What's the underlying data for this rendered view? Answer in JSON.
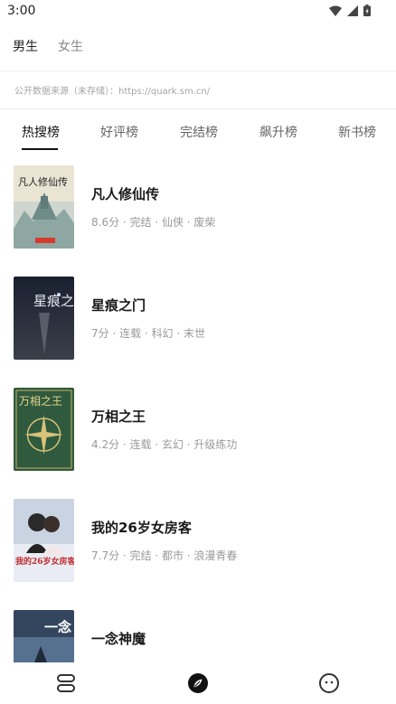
{
  "status": {
    "time": "3:00"
  },
  "gender_tabs": [
    {
      "label": "男生",
      "active": true
    },
    {
      "label": "女生",
      "active": false
    }
  ],
  "source_note": "公开数据来源（未存储）：https://quark.sm.cn/",
  "rank_tabs": [
    {
      "label": "热搜榜",
      "active": true
    },
    {
      "label": "好评榜",
      "active": false
    },
    {
      "label": "完结榜",
      "active": false
    },
    {
      "label": "飙升榜",
      "active": false
    },
    {
      "label": "新书榜",
      "active": false
    }
  ],
  "books": [
    {
      "title": "凡人修仙传",
      "meta": "8.6分 · 完结 · 仙侠 · 废柴",
      "cover_text": "凡人修仙传"
    },
    {
      "title": "星痕之门",
      "meta": "7分 · 连载 · 科幻 · 末世",
      "cover_text": "星痕之门"
    },
    {
      "title": "万相之王",
      "meta": "4.2分 · 连载 · 玄幻 · 升级练功",
      "cover_text": "万相之王"
    },
    {
      "title": "我的26岁女房客",
      "meta": "7.7分 · 完结 · 都市 · 浪漫青春",
      "cover_text": "我的26岁女房客"
    },
    {
      "title": "一念神魔",
      "meta": "",
      "cover_text": "一念"
    }
  ],
  "nav": [
    {
      "icon": "bookshelf-icon"
    },
    {
      "icon": "compass-icon"
    },
    {
      "icon": "face-icon"
    }
  ],
  "colors": {
    "accent": "#111111",
    "muted": "#9a9a9a"
  }
}
